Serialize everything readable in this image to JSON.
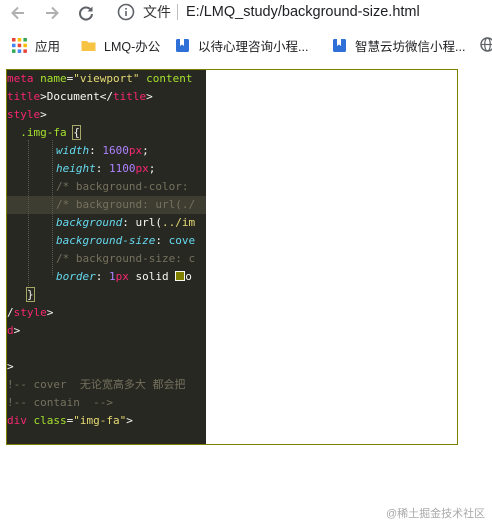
{
  "browser": {
    "scheme_label": "文件",
    "url": "E:/LMQ_study/background-size.html"
  },
  "bookmarks": [
    {
      "label": "应用",
      "icon": "apps-grid-icon"
    },
    {
      "label": "LMQ-办公",
      "icon": "folder-icon"
    },
    {
      "label": "以待心理咨询小程...",
      "icon": "bookmark-icon"
    },
    {
      "label": "智慧云坊微信小程...",
      "icon": "bookmark-icon"
    }
  ],
  "code": {
    "l1": [
      "meta ",
      "name",
      "=",
      "\"viewport\"",
      " content"
    ],
    "l2": [
      "title",
      ">Document</",
      "title",
      ">"
    ],
    "l3": [
      "style",
      ">"
    ],
    "l4": [
      "  .img-fa ",
      "{"
    ],
    "l5": [
      "width",
      ": ",
      "1600",
      "px",
      ";"
    ],
    "l6": [
      "height",
      ": ",
      "1100",
      "px",
      ";"
    ],
    "l7": "/* background-color: ",
    "l8": "/* background: url(./",
    "l9": [
      "background",
      ": url(",
      "../im"
    ],
    "l10": [
      "background-size",
      ": ",
      "cove"
    ],
    "l11": "/* background-size: c",
    "l12": [
      "border",
      ": ",
      "1",
      "px",
      " solid ",
      "o"
    ],
    "l13": "}",
    "l14": [
      "/",
      "style",
      ">"
    ],
    "l15": [
      "d",
      ">"
    ],
    "l16": ">",
    "l17": "!-- cover  无论宽高多大 都会把",
    "l18": "!-- contain  -->",
    "l19": [
      "div ",
      "class",
      "=",
      "\"img-fa\"",
      ">"
    ]
  },
  "colors": {
    "border": "#808000",
    "editor_bg": "#272822"
  },
  "watermark": "@稀土掘金技术社区"
}
